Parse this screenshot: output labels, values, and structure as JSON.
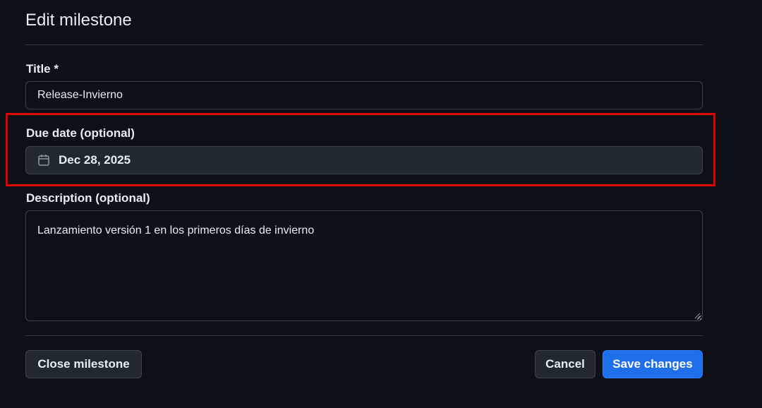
{
  "heading": "Edit milestone",
  "form": {
    "title_label": "Title *",
    "title_value": "Release-Invierno",
    "due_label": "Due date (optional)",
    "due_value": "Dec 28, 2025",
    "description_label": "Description (optional)",
    "description_value": "Lanzamiento versión 1 en los primeros días de invierno"
  },
  "actions": {
    "close_label": "Close milestone",
    "cancel_label": "Cancel",
    "save_label": "Save changes"
  },
  "colors": {
    "background": "#0d1117",
    "primary": "#1f6feb",
    "highlight": "#e00000"
  },
  "icons": {
    "due_date": "calendar-icon"
  }
}
